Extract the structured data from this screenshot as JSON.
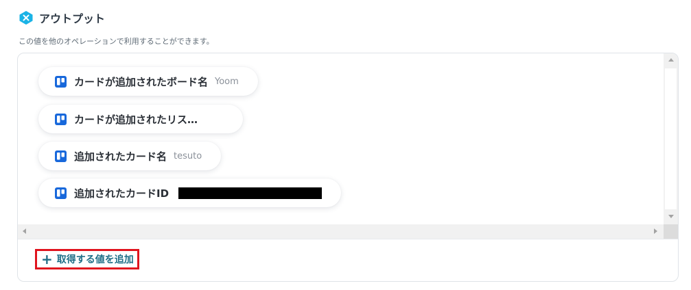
{
  "header": {
    "title": "アウトプット",
    "description": "この値を他のオペレーションで利用することができます。"
  },
  "outputs": [
    {
      "label": "カードが追加されたボード名",
      "value": "Yoom",
      "icon": "trello-icon"
    },
    {
      "label": "カードが追加されたリス…",
      "value": "",
      "icon": "trello-icon"
    },
    {
      "label": "追加されたカード名",
      "value": "tesuto",
      "icon": "trello-icon"
    },
    {
      "label": "追加されたカードID",
      "value": "",
      "redacted": true,
      "icon": "trello-icon"
    }
  ],
  "actions": {
    "add_value_label": "取得する値を追加"
  },
  "colors": {
    "accent": "#1f6e87",
    "highlight_border": "#e0141e",
    "trello_blue": "#1868db",
    "logo_cyan": "#1ab3e6"
  }
}
